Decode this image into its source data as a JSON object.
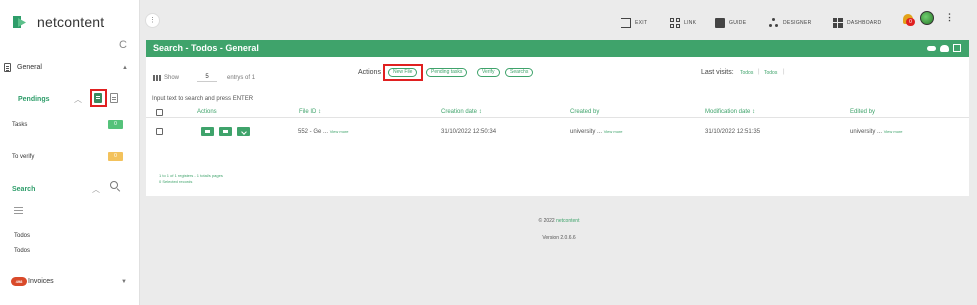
{
  "brand": {
    "name": "netcontent"
  },
  "sidebar": {
    "general_label": "General",
    "pendings_title": "Pendings",
    "pendings": [
      {
        "label": "Tasks",
        "count": "0",
        "color": "#55c27a"
      },
      {
        "label": "To verify",
        "count": "0",
        "color": "#f3c25c"
      }
    ],
    "search_title": "Search",
    "search_items": [
      "Todos",
      "Todos"
    ],
    "invoices_badge": "498",
    "invoices_label": "Invoices"
  },
  "topbar": {
    "menu_glyph": "⋮",
    "nav": [
      {
        "label": "EXIT",
        "icon": "exit-icon"
      },
      {
        "label": "LINK",
        "icon": "qr-link-icon"
      },
      {
        "label": "GUIDE",
        "icon": "guide-icon"
      },
      {
        "label": "DESIGNER",
        "icon": "designer-icon"
      },
      {
        "label": "DASHBOARD",
        "icon": "dashboard-icon"
      }
    ],
    "notification_count": "0",
    "kebab_glyph": "⋮"
  },
  "panel": {
    "title": "Search - Todos - General",
    "show_label": "Show",
    "show_value": "5",
    "entries_label": "entrys of 1",
    "actions_label": "Actions",
    "action_buttons": [
      "New File",
      "Pending tasks",
      "Verify",
      "Searchs"
    ],
    "last_visits_label": "Last visits:",
    "last_visits": [
      "Todos",
      "Todos"
    ],
    "hint": "Input text to search and press ENTER",
    "columns": [
      "Actions",
      "File ID ↕",
      "Creation date ↕",
      "Created by",
      "Modification date ↕",
      "Edited by"
    ],
    "row": {
      "file_id": "552 - Ge ...",
      "file_id_more": "View more",
      "creation_date": "31/10/2022 12:50:34",
      "created_by": "university ...",
      "created_by_more": "View more",
      "modification_date": "31/10/2022 12:51:35",
      "edited_by": "university ...",
      "edited_by_more": "View more"
    },
    "registers_text": "1 to 1 of 1 registers - 1 total/s pages",
    "selected_text": "0 Selected records"
  },
  "footer": {
    "copyright_prefix": "© 2022",
    "copyright_brand": "netcontent",
    "version": "Version 2.0.6.6"
  },
  "colors": {
    "accent": "#3fa36b",
    "highlight": "#e02020"
  }
}
